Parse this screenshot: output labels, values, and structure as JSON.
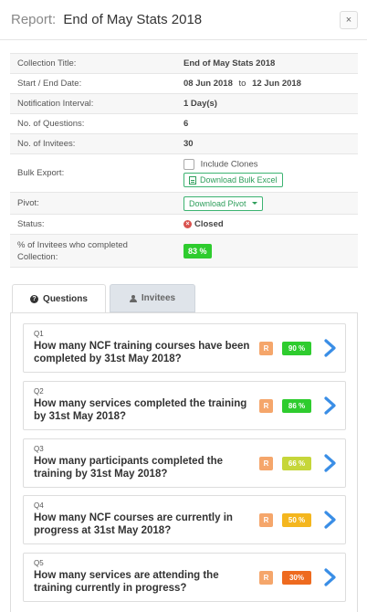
{
  "header": {
    "prefix": "Report:",
    "title": "End of May Stats 2018",
    "close_label": "×"
  },
  "info": {
    "collection_title_label": "Collection Title:",
    "collection_title": "End of May Stats 2018",
    "dates_label": "Start / End Date:",
    "start_date": "08 Jun 2018",
    "date_sep": "to",
    "end_date": "12 Jun 2018",
    "interval_label": "Notification Interval:",
    "interval": "1 Day(s)",
    "questions_label": "No. of Questions:",
    "questions": "6",
    "invitees_label": "No. of Invitees:",
    "invitees": "30",
    "bulk_label": "Bulk Export:",
    "include_clones": "Include Clones",
    "download_bulk": "Download Bulk Excel",
    "pivot_label": "Pivot:",
    "download_pivot": "Download Pivot",
    "status_label": "Status:",
    "status": "Closed",
    "completed_label": "% of Invitees who completed Collection:",
    "completed": "83 %"
  },
  "tabs": [
    {
      "label": "Questions"
    },
    {
      "label": "Invitees"
    }
  ],
  "questions": [
    {
      "num": "Q1",
      "text": "How many NCF training courses have been completed by 31st May 2018?",
      "r": "R",
      "pct": "90 %",
      "color": "#2ecc2e"
    },
    {
      "num": "Q2",
      "text": "How many services completed the training by 31st May 2018?",
      "r": "R",
      "pct": "86 %",
      "color": "#2ecc2e"
    },
    {
      "num": "Q3",
      "text": "How many participants completed the training by 31st May 2018?",
      "r": "R",
      "pct": "66 %",
      "color": "#c6d63a"
    },
    {
      "num": "Q4",
      "text": "How many NCF courses are currently in progress at 31st May 2018?",
      "r": "R",
      "pct": "50 %",
      "color": "#f4b61e"
    },
    {
      "num": "Q5",
      "text": "How many services are attending the training currently in progress?",
      "r": "R",
      "pct": "30%",
      "color": "#ee6a1f"
    }
  ]
}
